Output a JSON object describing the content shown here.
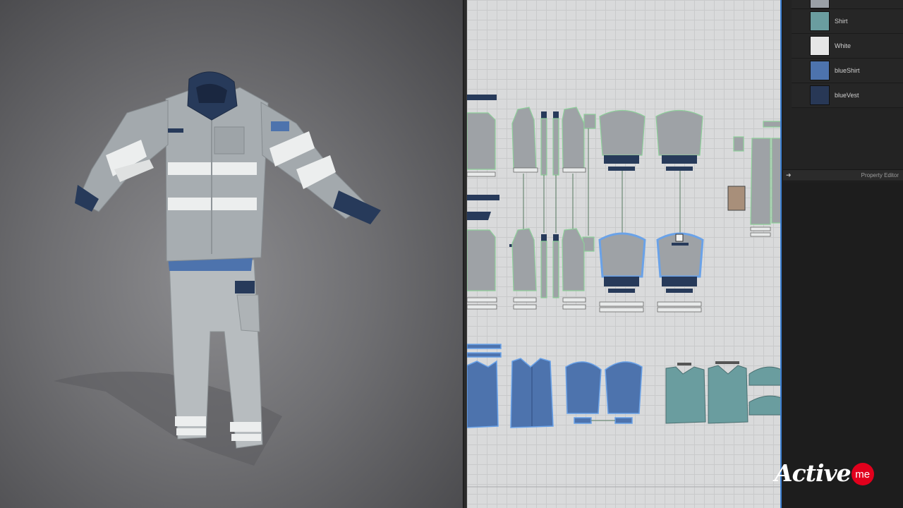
{
  "fabrics": [
    {
      "name": "Shirt",
      "color": "#6a9d9f"
    },
    {
      "name": "White",
      "color": "#e6e6e6"
    },
    {
      "name": "blueShirt",
      "color": "#4d73ad"
    },
    {
      "name": "blueVest",
      "color": "#283856"
    }
  ],
  "fabric_partial_top_color": "#9aa0a6",
  "property_editor": {
    "label": "Property Editor"
  },
  "logo": {
    "text": "Active",
    "badge": "me"
  },
  "colors": {
    "jacket_grey": "#a7adb1",
    "navy": "#273a5a",
    "reflective_white": "#eceeee",
    "pattern_grey": "#9ea2a6",
    "selection_blue": "#6aa2e8",
    "outline_green": "#8ecf9a"
  }
}
